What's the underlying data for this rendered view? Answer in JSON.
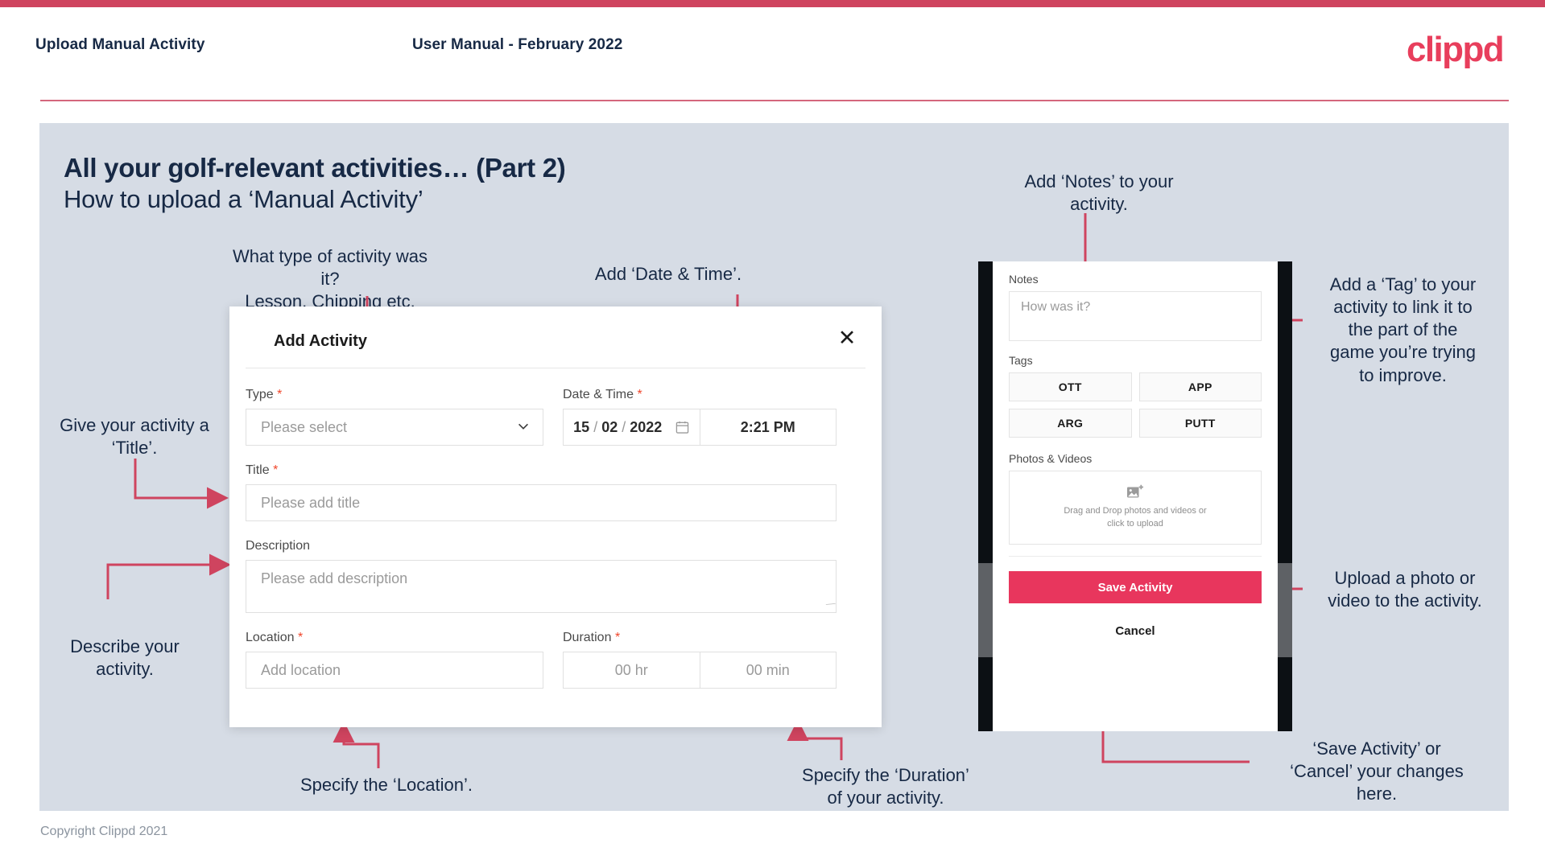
{
  "header": {
    "left_title": "Upload Manual Activity",
    "center_title": "User Manual - February 2022",
    "logo_text": "clippd"
  },
  "slide": {
    "title": "All your golf-relevant activities… (Part 2)",
    "subtitle": "How to upload a ‘Manual Activity’",
    "copyright": "Copyright Clippd 2021"
  },
  "callouts": {
    "type": "What type of activity was it?\nLesson, Chipping etc.",
    "datetime": "Add ‘Date & Time’.",
    "title": "Give your activity a\n‘Title’.",
    "description": "Describe your\nactivity.",
    "location": "Specify the ‘Location’.",
    "duration": "Specify the ‘Duration’\nof your activity.",
    "notes": "Add ‘Notes’ to your\nactivity.",
    "tags": "Add a ‘Tag’ to your\nactivity to link it to\nthe part of the\ngame you’re trying\nto improve.",
    "photos": "Upload a photo or\nvideo to the activity.",
    "save": "‘Save Activity’ or\n‘Cancel’ your changes\nhere."
  },
  "dialog": {
    "title": "Add Activity",
    "close_label": "✕",
    "type": {
      "label": "Type",
      "required": "*",
      "placeholder": "Please select"
    },
    "datetime": {
      "label": "Date & Time",
      "required": "*",
      "day": "15",
      "month": "02",
      "year": "2022",
      "sep1": "/",
      "sep2": "/",
      "time": "2:21 PM"
    },
    "activity_title": {
      "label": "Title",
      "required": "*",
      "placeholder": "Please add title"
    },
    "description": {
      "label": "Description",
      "placeholder": "Please add description"
    },
    "location": {
      "label": "Location",
      "required": "*",
      "placeholder": "Add location"
    },
    "duration": {
      "label": "Duration",
      "required": "*",
      "hours": "00 hr",
      "minutes": "00 min"
    }
  },
  "phone": {
    "notes_label": "Notes",
    "notes_placeholder": "How was it?",
    "tags_label": "Tags",
    "tags": [
      "OTT",
      "APP",
      "ARG",
      "PUTT"
    ],
    "photos_label": "Photos & Videos",
    "drop_line1": "Drag and Drop photos and videos or",
    "drop_line2": "click to upload",
    "save_label": "Save Activity",
    "cancel_label": "Cancel"
  },
  "colors": {
    "brand_pink": "#e83e5c",
    "save_button": "#e8365d",
    "arrow": "#cf445f",
    "slide_bg": "#d6dce5",
    "text_dark": "#172945",
    "required_star": "#f0452a"
  }
}
